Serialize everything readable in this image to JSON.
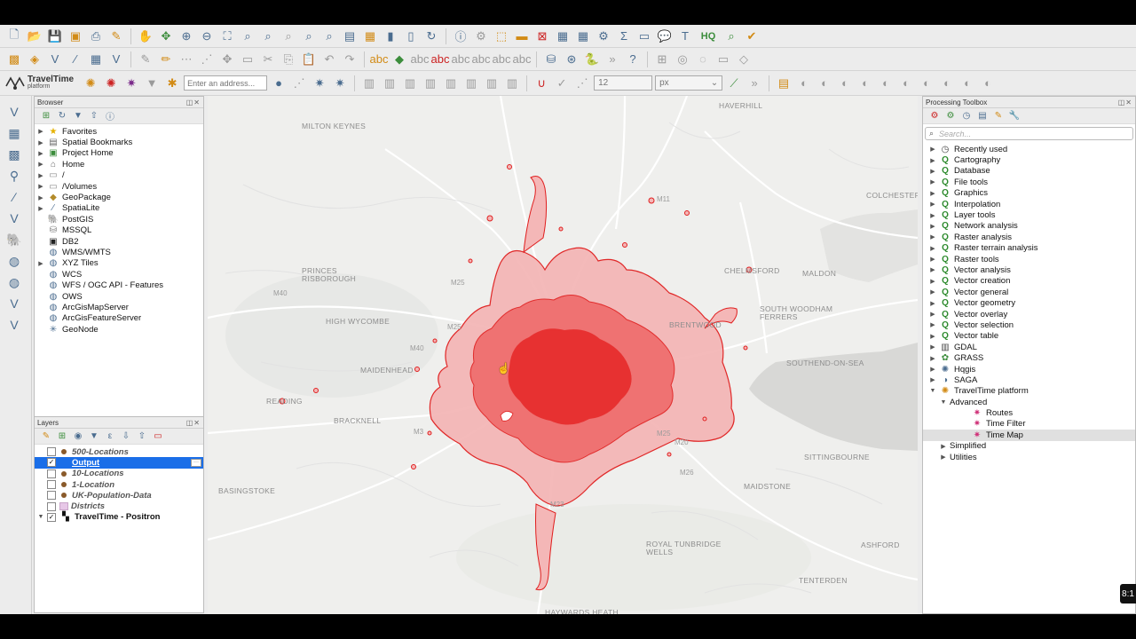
{
  "toolbar": {
    "travel_logo_line1": "TravelTime",
    "travel_logo_line2": "platform",
    "address_placeholder": "Enter an address...",
    "size_value": "12",
    "size_unit": "px"
  },
  "browser": {
    "title": "Browser",
    "items": [
      {
        "label": "Favorites",
        "icon": "star-icon"
      },
      {
        "label": "Spatial Bookmarks",
        "icon": "bookmark-icon"
      },
      {
        "label": "Project Home",
        "icon": "project-home-icon"
      },
      {
        "label": "Home",
        "icon": "home-folder-icon"
      },
      {
        "label": "/",
        "icon": "folder-icon"
      },
      {
        "label": "/Volumes",
        "icon": "folder-icon"
      },
      {
        "label": "GeoPackage",
        "icon": "geopackage-icon"
      },
      {
        "label": "SpatiaLite",
        "icon": "spatialite-icon"
      },
      {
        "label": "PostGIS",
        "icon": "postgis-icon"
      },
      {
        "label": "MSSQL",
        "icon": "mssql-icon"
      },
      {
        "label": "DB2",
        "icon": "db2-icon"
      },
      {
        "label": "WMS/WMTS",
        "icon": "globe-icon"
      },
      {
        "label": "XYZ Tiles",
        "icon": "tiles-icon"
      },
      {
        "label": "WCS",
        "icon": "globe-icon"
      },
      {
        "label": "WFS / OGC API - Features",
        "icon": "globe-icon"
      },
      {
        "label": "OWS",
        "icon": "globe-icon"
      },
      {
        "label": "ArcGisMapServer",
        "icon": "globe-icon"
      },
      {
        "label": "ArcGisFeatureServer",
        "icon": "globe-icon"
      },
      {
        "label": "GeoNode",
        "icon": "geonode-icon"
      }
    ]
  },
  "layers": {
    "title": "Layers",
    "items": [
      {
        "label": "500-Locations"
      },
      {
        "label": "Output"
      },
      {
        "label": "10-Locations"
      },
      {
        "label": "1-Location"
      },
      {
        "label": "UK-Population-Data"
      },
      {
        "label": "Districts"
      },
      {
        "label": "TravelTime - Positron"
      }
    ]
  },
  "toolbox": {
    "title": "Processing Toolbox",
    "search_placeholder": "Search...",
    "items": [
      {
        "label": "Recently used"
      },
      {
        "label": "Cartography"
      },
      {
        "label": "Database"
      },
      {
        "label": "File tools"
      },
      {
        "label": "Graphics"
      },
      {
        "label": "Interpolation"
      },
      {
        "label": "Layer tools"
      },
      {
        "label": "Network analysis"
      },
      {
        "label": "Raster analysis"
      },
      {
        "label": "Raster terrain analysis"
      },
      {
        "label": "Raster tools"
      },
      {
        "label": "Vector analysis"
      },
      {
        "label": "Vector creation"
      },
      {
        "label": "Vector general"
      },
      {
        "label": "Vector geometry"
      },
      {
        "label": "Vector overlay"
      },
      {
        "label": "Vector selection"
      },
      {
        "label": "Vector table"
      },
      {
        "label": "GDAL"
      },
      {
        "label": "GRASS"
      },
      {
        "label": "Hqgis"
      },
      {
        "label": "SAGA"
      },
      {
        "label": "TravelTime platform"
      },
      {
        "label": "Advanced"
      },
      {
        "label": "Routes"
      },
      {
        "label": "Time Filter"
      },
      {
        "label": "Time Map"
      },
      {
        "label": "Simplified"
      },
      {
        "label": "Utilities"
      }
    ]
  },
  "map": {
    "places": [
      "HAVERHILL",
      "MILTON KEYNES",
      "COLCHESTER",
      "PRINCES\nRISBOROUGH",
      "CHELMSFORD",
      "MALDON",
      "HIGH WYCOMBE",
      "SOUTH WOODHAM\nFERRERS",
      "BRENTWOOD",
      "MAIDENHEAD",
      "SOUTHEND-ON-SEA",
      "READING",
      "BRACKNELL",
      "SITTINGBOURNE",
      "BASINGSTOKE",
      "MAIDSTONE",
      "ROYAL TUNBRIDGE\nWELLS",
      "ASHFORD",
      "TENTERDEN",
      "HAYWARDS HEATH"
    ],
    "roads": [
      "M11",
      "M40",
      "M40",
      "M25",
      "M25",
      "M3",
      "M20",
      "M26",
      "M23",
      "M25"
    ]
  },
  "video": {
    "time_badge": "8:1"
  }
}
